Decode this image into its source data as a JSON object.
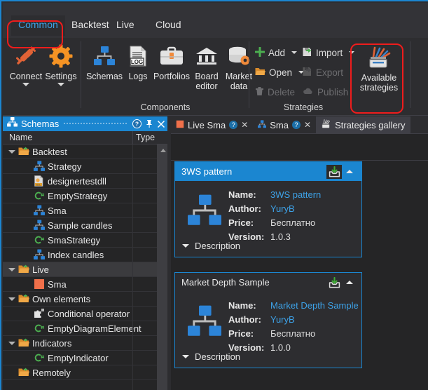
{
  "ribbon": {
    "tabs": [
      {
        "label": "Common",
        "active": true
      },
      {
        "label": "Backtest",
        "active": false
      },
      {
        "label": "Live",
        "active": false
      },
      {
        "label": "Cloud",
        "active": false
      }
    ],
    "groups": [
      {
        "name": "connection_group",
        "label": ""
      },
      {
        "name": "components_group",
        "label": "Components"
      },
      {
        "name": "strategies_group",
        "label": "Strategies"
      }
    ],
    "big_buttons": [
      {
        "name": "connect",
        "label": "Connect",
        "icon": "plug-icon",
        "dropdown": true
      },
      {
        "name": "settings",
        "label": "Settings",
        "icon": "gear-icon",
        "dropdown": true
      },
      {
        "name": "schemas",
        "label": "Schemas",
        "icon": "diagram-icon",
        "dropdown": false
      },
      {
        "name": "logs",
        "label": "Logs",
        "icon": "log-file-icon",
        "dropdown": false
      },
      {
        "name": "portfolios",
        "label": "Portfolios",
        "icon": "briefcase-icon",
        "dropdown": false
      },
      {
        "name": "board-editor",
        "label": "Board editor",
        "icon": "bank-icon",
        "dropdown": false
      },
      {
        "name": "market-data",
        "label": "Market data",
        "icon": "database-gear-icon",
        "dropdown": false
      },
      {
        "name": "available-strategies",
        "label": "Available strategies",
        "icon": "strategies-gallery-icon",
        "dropdown": false
      }
    ],
    "small_buttons": [
      {
        "name": "add",
        "label": "Add",
        "icon": "plus-icon",
        "dropdown": true,
        "disabled": false
      },
      {
        "name": "open",
        "label": "Open",
        "icon": "folder-open-icon",
        "dropdown": true,
        "disabled": false
      },
      {
        "name": "delete",
        "label": "Delete",
        "icon": "trash-icon",
        "dropdown": false,
        "disabled": true
      },
      {
        "name": "import",
        "label": "Import",
        "icon": "import-icon",
        "dropdown": true,
        "disabled": false
      },
      {
        "name": "export",
        "label": "Export",
        "icon": "export-icon",
        "dropdown": false,
        "disabled": true
      },
      {
        "name": "publish",
        "label": "Publish",
        "icon": "cloud-icon",
        "dropdown": false,
        "disabled": true
      }
    ],
    "highlight_color": "#ef1c1c"
  },
  "schemas_panel": {
    "title": "Schemas",
    "help_icon": "help-icon",
    "pin_icon": "pin-icon",
    "close_icon": "close-icon",
    "columns": {
      "name": "Name",
      "type": "Type"
    },
    "rows": [
      {
        "label": "Backtest",
        "icon": "folder-icon",
        "indent": 0,
        "expander": true,
        "selected": false
      },
      {
        "label": "Strategy",
        "icon": "diagram-icon",
        "indent": 1,
        "expander": false,
        "selected": false
      },
      {
        "label": "designertestdll",
        "icon": "dll-file-icon",
        "indent": 1,
        "expander": false,
        "selected": false
      },
      {
        "label": "EmptyStrategy",
        "icon": "csharp-icon",
        "indent": 1,
        "expander": false,
        "selected": false
      },
      {
        "label": "Sma",
        "icon": "diagram-icon",
        "indent": 1,
        "expander": false,
        "selected": false
      },
      {
        "label": "Sample candles",
        "icon": "diagram-icon",
        "indent": 1,
        "expander": false,
        "selected": false
      },
      {
        "label": "SmaStrategy",
        "icon": "csharp-icon",
        "indent": 1,
        "expander": false,
        "selected": false
      },
      {
        "label": "Index candles",
        "icon": "diagram-icon",
        "indent": 1,
        "expander": false,
        "selected": false
      },
      {
        "label": "Live",
        "icon": "folder-icon",
        "indent": 0,
        "expander": true,
        "selected": true
      },
      {
        "label": "Sma",
        "icon": "orange-square-icon",
        "indent": 1,
        "expander": false,
        "selected": false
      },
      {
        "label": "Own elements",
        "icon": "folder-icon",
        "indent": 0,
        "expander": true,
        "selected": false
      },
      {
        "label": "Conditional operator",
        "icon": "puzzle-icon",
        "indent": 1,
        "expander": false,
        "selected": false
      },
      {
        "label": "EmptyDiagramElement",
        "icon": "csharp-icon",
        "indent": 1,
        "expander": false,
        "selected": false
      },
      {
        "label": "Indicators",
        "icon": "folder-icon",
        "indent": 0,
        "expander": true,
        "selected": false
      },
      {
        "label": "EmptyIndicator",
        "icon": "csharp-icon",
        "indent": 1,
        "expander": false,
        "selected": false
      },
      {
        "label": "Remotely",
        "icon": "folder-icon",
        "indent": 0,
        "expander": false,
        "selected": false
      },
      {
        "label": "",
        "icon": "none",
        "indent": 0,
        "expander": false,
        "selected": false
      }
    ]
  },
  "document_tabs": [
    {
      "label": "Live Sma",
      "icon": "orange-square-icon",
      "has_help": true,
      "has_close": true,
      "active": false
    },
    {
      "label": "Sma",
      "icon": "diagram-icon",
      "has_help": true,
      "has_close": true,
      "active": false
    },
    {
      "label": "Strategies gallery",
      "icon": "strategies-gallery-icon",
      "has_help": false,
      "has_close": false,
      "active": true
    }
  ],
  "gallery": {
    "labels": {
      "name": "Name:",
      "author": "Author:",
      "price": "Price:",
      "version": "Version:",
      "description": "Description"
    },
    "download_icon": "download-icon",
    "collapse_icon": "chevron-up-icon",
    "expand_icon": "chevron-down-icon",
    "cards": [
      {
        "title": "3WS pattern",
        "name": "3WS pattern",
        "author": "YuryB",
        "price": "Бесплатно",
        "version": "1.0.3",
        "header_highlighted": true,
        "icon": "diagram-icon"
      },
      {
        "title": "Market Depth Sample",
        "name": "Market Depth Sample",
        "author": "YuryB",
        "price": "Бесплатно",
        "version": "1.0.0",
        "header_highlighted": false,
        "icon": "diagram-icon"
      }
    ]
  },
  "theme": {
    "accent": "#1b86d0",
    "link": "#3da2e8",
    "background": "#2d2d30",
    "panel": "#252526",
    "orange": "#f07845",
    "green": "#5aa832"
  }
}
